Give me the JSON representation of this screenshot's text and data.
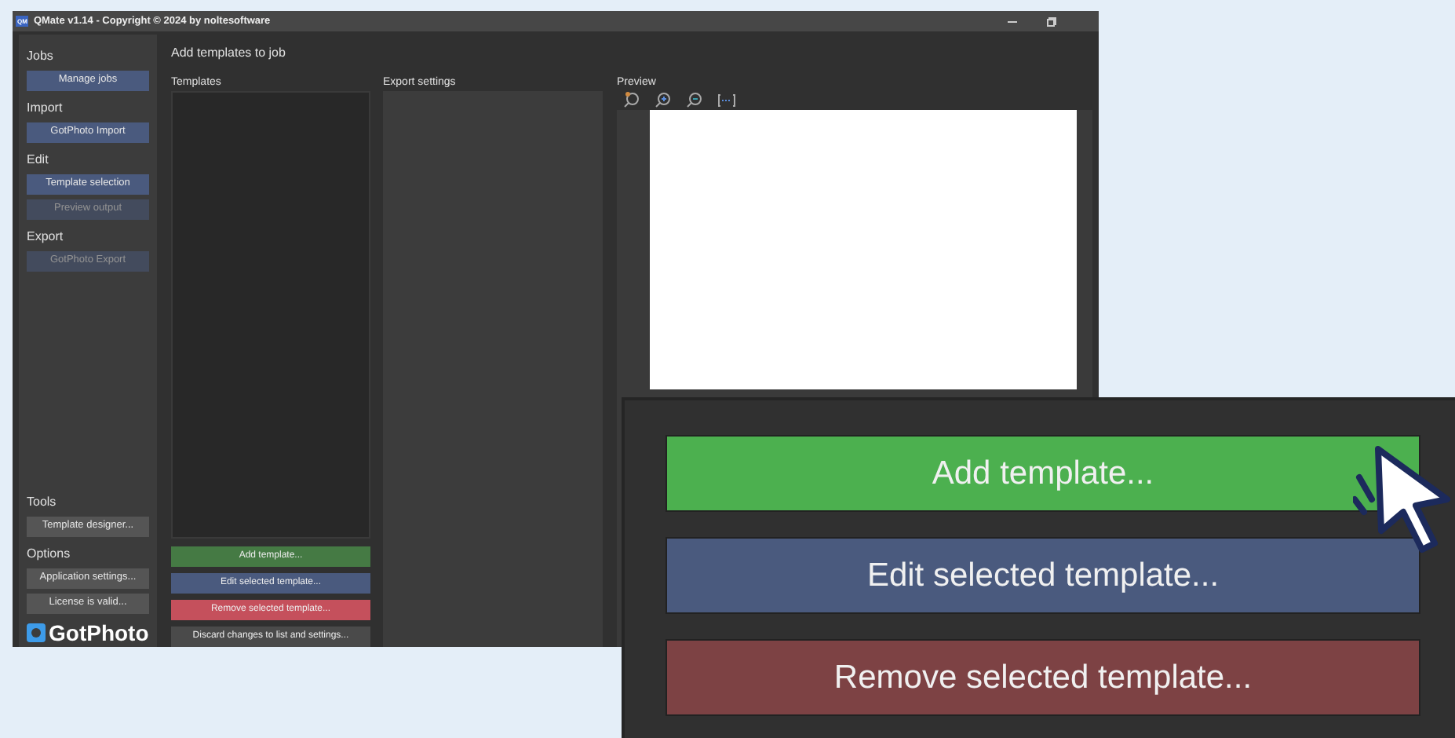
{
  "window": {
    "title": "QMate v1.14 - Copyright © 2024 by noltesoftware",
    "app_icon": "QM"
  },
  "sidebar": {
    "top_sections": [
      {
        "heading": "Jobs",
        "buttons": [
          {
            "label": "Manage jobs",
            "disabled": false
          }
        ]
      },
      {
        "heading": "Import",
        "buttons": [
          {
            "label": "GotPhoto Import",
            "disabled": false
          }
        ]
      },
      {
        "heading": "Edit",
        "buttons": [
          {
            "label": "Template selection",
            "disabled": false
          },
          {
            "label": "Preview output",
            "disabled": true
          }
        ]
      },
      {
        "heading": "Export",
        "buttons": [
          {
            "label": "GotPhoto Export",
            "disabled": true
          }
        ]
      }
    ],
    "bottom_sections": [
      {
        "heading": "Tools",
        "buttons": [
          {
            "label": "Template designer...",
            "disabled": false
          }
        ]
      },
      {
        "heading": "Options",
        "buttons": [
          {
            "label": "Application settings...",
            "disabled": false
          },
          {
            "label": "License is valid...",
            "disabled": false
          }
        ]
      }
    ],
    "logo": "GotPhoto"
  },
  "main": {
    "title": "Add templates to job",
    "templates": {
      "heading": "Templates",
      "buttons": [
        {
          "label": "Add template...",
          "kind": "add"
        },
        {
          "label": "Edit selected template...",
          "kind": "edit"
        },
        {
          "label": "Remove selected template...",
          "kind": "remove"
        },
        {
          "label": "Discard changes to list and settings...",
          "kind": "neutral"
        }
      ]
    },
    "export_settings": {
      "heading": "Export settings"
    },
    "preview": {
      "heading": "Preview"
    }
  },
  "zoom_callout": {
    "buttons": [
      {
        "label": "Add template...",
        "kind": "add"
      },
      {
        "label": "Edit selected template...",
        "kind": "edit"
      },
      {
        "label": "Remove selected template...",
        "kind": "remove"
      }
    ]
  }
}
